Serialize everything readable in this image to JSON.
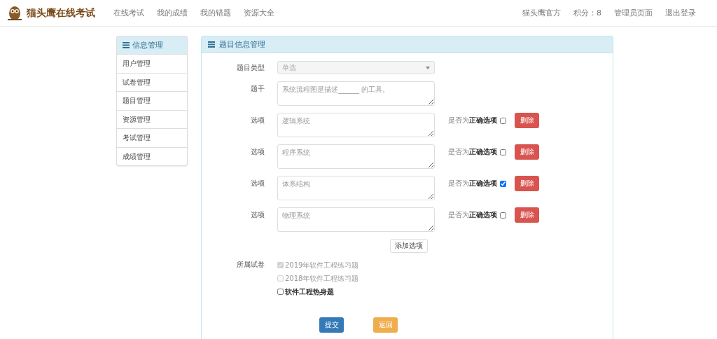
{
  "brand": {
    "title": "猫头鹰在线考试"
  },
  "nav": [
    {
      "label": "在线考试"
    },
    {
      "label": "我的成绩"
    },
    {
      "label": "我的错题"
    },
    {
      "label": "资源大全"
    }
  ],
  "nav_right": [
    {
      "label": "猫头鹰官方"
    },
    {
      "label": "积分：8"
    },
    {
      "label": "管理员页面"
    },
    {
      "label": "退出登录"
    }
  ],
  "sidebar": {
    "title": "信息管理",
    "items": [
      {
        "label": "用户管理"
      },
      {
        "label": "试卷管理"
      },
      {
        "label": "题目管理"
      },
      {
        "label": "资源管理"
      },
      {
        "label": "考试管理"
      },
      {
        "label": "成绩管理"
      }
    ]
  },
  "panel": {
    "title": "题目信息管理"
  },
  "form": {
    "type_label": "题目类型",
    "type_value": "单选",
    "stem_label": "题干",
    "stem_value": "系统流程图是描述______ 的工具。",
    "options": [
      {
        "label": "选项",
        "value": "逻辑系统",
        "correct_prefix": "是否为",
        "correct_label": "正确选项",
        "checked": false,
        "delete": "删除"
      },
      {
        "label": "选项",
        "value": "程序系统",
        "correct_prefix": "是否为",
        "correct_label": "正确选项",
        "checked": false,
        "delete": "删除"
      },
      {
        "label": "选项",
        "value": "体系结构",
        "correct_prefix": "是否为",
        "correct_label": "正确选项",
        "checked": true,
        "delete": "删除"
      },
      {
        "label": "选项",
        "value": "物理系统",
        "correct_prefix": "是否为",
        "correct_label": "正确选项",
        "checked": false,
        "delete": "删除"
      }
    ],
    "add_option": "添加选项",
    "papers_label": "所属试卷",
    "papers": [
      {
        "label": "2019年软件工程练习题",
        "checked": true,
        "disabled": true
      },
      {
        "label": "2018年软件工程练习题",
        "checked": false,
        "disabled": true
      },
      {
        "label": "软件工程热身题",
        "checked": false,
        "disabled": false
      }
    ],
    "submit": "提交",
    "back": "返回"
  }
}
